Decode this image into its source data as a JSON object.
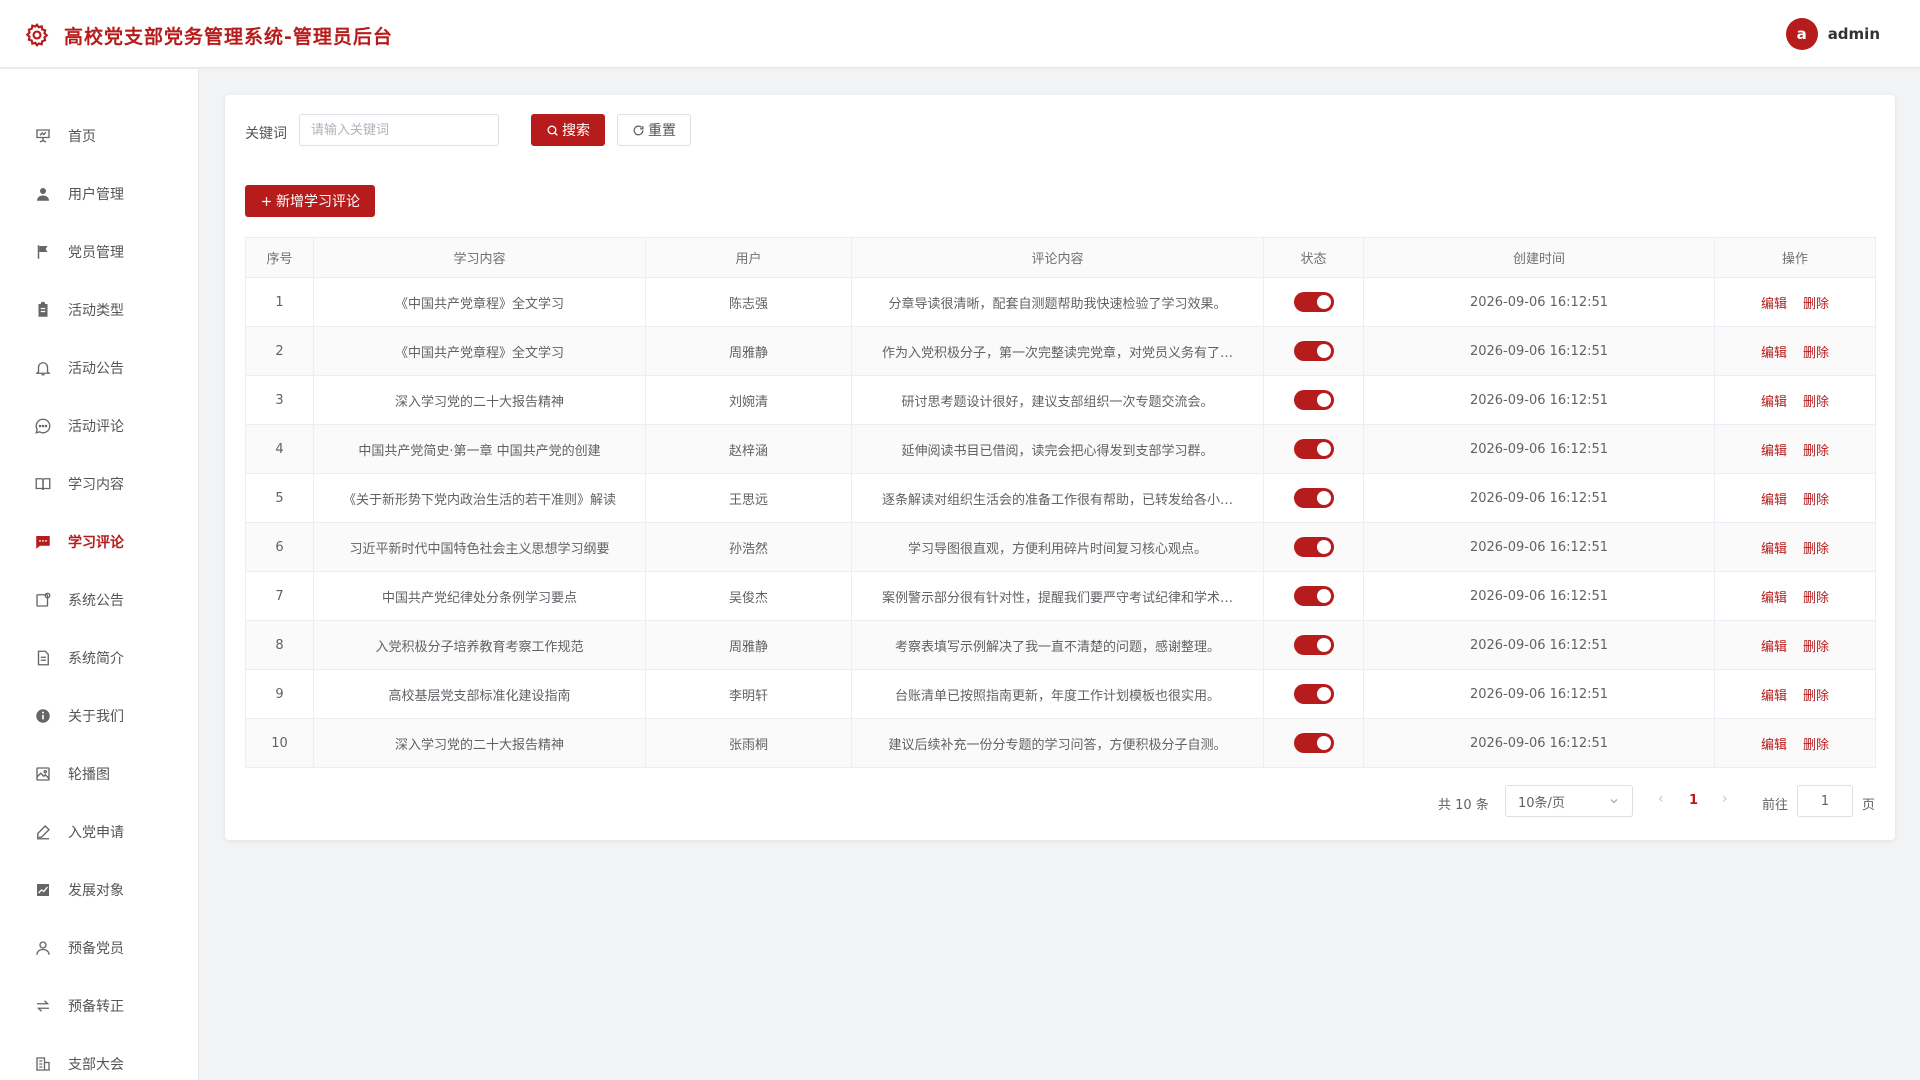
{
  "header": {
    "title": "高校党支部党务管理系统-管理员后台",
    "avatar_letter": "a",
    "username": "admin",
    "brand_color": "#b71c1c"
  },
  "sidebar": {
    "items": [
      {
        "label": "首页",
        "icon": "presentation-icon"
      },
      {
        "label": "用户管理",
        "icon": "user-icon"
      },
      {
        "label": "党员管理",
        "icon": "flag-icon"
      },
      {
        "label": "活动类型",
        "icon": "clipboard-icon"
      },
      {
        "label": "活动公告",
        "icon": "bell-icon"
      },
      {
        "label": "活动评论",
        "icon": "chat-icon"
      },
      {
        "label": "学习内容",
        "icon": "book-icon"
      },
      {
        "label": "学习评论",
        "icon": "comment-icon",
        "active": true
      },
      {
        "label": "系统公告",
        "icon": "notice-icon"
      },
      {
        "label": "系统简介",
        "icon": "document-icon"
      },
      {
        "label": "关于我们",
        "icon": "info-icon"
      },
      {
        "label": "轮播图",
        "icon": "picture-icon"
      },
      {
        "label": "入党申请",
        "icon": "pen-icon"
      },
      {
        "label": "发展对象",
        "icon": "trend-icon"
      },
      {
        "label": "预备党员",
        "icon": "user-outline-icon"
      },
      {
        "label": "预备转正",
        "icon": "switch-icon"
      },
      {
        "label": "支部大会",
        "icon": "building-icon"
      }
    ]
  },
  "search": {
    "label": "关键词",
    "placeholder": "请输入关键词",
    "value": "",
    "search_label": "搜索",
    "reset_label": "重置"
  },
  "toolbar": {
    "add_label": "新增学习评论"
  },
  "table": {
    "headers": [
      "序号",
      "学习内容",
      "用户",
      "评论内容",
      "状态",
      "创建时间",
      "操作"
    ],
    "edit_label": "编辑",
    "delete_label": "删除",
    "rows": [
      {
        "no": "1",
        "content": "《中国共产党章程》全文学习",
        "user": "陈志强",
        "comment": "分章导读很清晰，配套自测题帮助我快速检验了学习效果。",
        "status": true,
        "time": "2026-09-06 16:12:51"
      },
      {
        "no": "2",
        "content": "《中国共产党章程》全文学习",
        "user": "周雅静",
        "comment": "作为入党积极分子，第一次完整读完党章，对党员义务有了…",
        "status": true,
        "time": "2026-09-06 16:12:51"
      },
      {
        "no": "3",
        "content": "深入学习党的二十大报告精神",
        "user": "刘婉清",
        "comment": "研讨思考题设计很好，建议支部组织一次专题交流会。",
        "status": true,
        "time": "2026-09-06 16:12:51"
      },
      {
        "no": "4",
        "content": "中国共产党简史·第一章 中国共产党的创建",
        "user": "赵梓涵",
        "comment": "延伸阅读书目已借阅，读完会把心得发到支部学习群。",
        "status": true,
        "time": "2026-09-06 16:12:51"
      },
      {
        "no": "5",
        "content": "《关于新形势下党内政治生活的若干准则》解读",
        "user": "王思远",
        "comment": "逐条解读对组织生活会的准备工作很有帮助，已转发给各小…",
        "status": true,
        "time": "2026-09-06 16:12:51"
      },
      {
        "no": "6",
        "content": "习近平新时代中国特色社会主义思想学习纲要",
        "user": "孙浩然",
        "comment": "学习导图很直观，方便利用碎片时间复习核心观点。",
        "status": true,
        "time": "2026-09-06 16:12:51"
      },
      {
        "no": "7",
        "content": "中国共产党纪律处分条例学习要点",
        "user": "吴俊杰",
        "comment": "案例警示部分很有针对性，提醒我们要严守考试纪律和学术…",
        "status": true,
        "time": "2026-09-06 16:12:51"
      },
      {
        "no": "8",
        "content": "入党积极分子培养教育考察工作规范",
        "user": "周雅静",
        "comment": "考察表填写示例解决了我一直不清楚的问题，感谢整理。",
        "status": true,
        "time": "2026-09-06 16:12:51"
      },
      {
        "no": "9",
        "content": "高校基层党支部标准化建设指南",
        "user": "李明轩",
        "comment": "台账清单已按照指南更新，年度工作计划模板也很实用。",
        "status": true,
        "time": "2026-09-06 16:12:51"
      },
      {
        "no": "10",
        "content": "深入学习党的二十大报告精神",
        "user": "张雨桐",
        "comment": "建议后续补充一份分专题的学习问答，方便积极分子自测。",
        "status": true,
        "time": "2026-09-06 16:12:51"
      }
    ]
  },
  "pagination": {
    "total_text": "共 10 条",
    "page_size_text": "10条/页",
    "current_page": "1",
    "goto_label": "前往",
    "goto_value": "1",
    "page_suffix": "页"
  }
}
